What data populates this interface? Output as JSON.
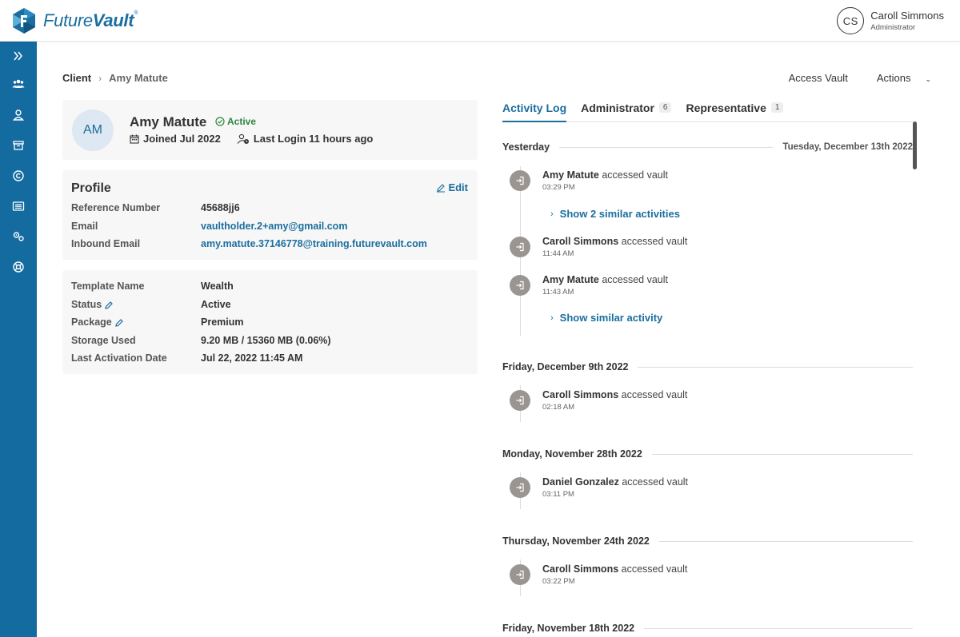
{
  "app": {
    "logo_text_a": "Future",
    "logo_text_b": "Vault",
    "logo_tm": "®"
  },
  "user": {
    "initials": "CS",
    "name": "Caroll Simmons",
    "role": "Administrator"
  },
  "sidebar": {
    "items": [
      {
        "icon": "expand-icon"
      },
      {
        "icon": "clients-icon"
      },
      {
        "icon": "user-icon"
      },
      {
        "icon": "archive-icon"
      },
      {
        "icon": "copyright-icon"
      },
      {
        "icon": "list-icon"
      },
      {
        "icon": "settings-icon"
      },
      {
        "icon": "support-icon"
      }
    ]
  },
  "breadcrumb": {
    "root": "Client",
    "separator": "›",
    "current": "Amy Matute"
  },
  "top_actions": {
    "access_vault": "Access Vault",
    "actions": "Actions",
    "actions_chevron": "⌄"
  },
  "client": {
    "initials": "AM",
    "name": "Amy Matute",
    "status": "Active",
    "joined": "Joined Jul 2022",
    "last_login": "Last Login 11 hours ago"
  },
  "profile": {
    "title": "Profile",
    "edit_label": "Edit",
    "fields": [
      {
        "label": "Reference Number",
        "value": "45688jj6"
      },
      {
        "label": "Email",
        "value": "vaultholder.2+amy@gmail.com"
      },
      {
        "label": "Inbound Email",
        "value": "amy.matute.37146778@training.futurevault.com"
      }
    ]
  },
  "details": {
    "fields": [
      {
        "label": "Template Name",
        "value": "Wealth"
      },
      {
        "label": "Status",
        "value": "Active"
      },
      {
        "label": "Package",
        "value": "Premium"
      },
      {
        "label": "Storage Used",
        "value": "9.20 MB / 15360 MB (0.06%)"
      },
      {
        "label": "Last Activation Date",
        "value": "Jul 22, 2022 11:45 AM"
      }
    ]
  },
  "tabs": [
    {
      "label": "Activity Log",
      "count": ""
    },
    {
      "label": "Administrator",
      "count": "6"
    },
    {
      "label": "Representative",
      "count": "1"
    }
  ],
  "activity": {
    "groups": [
      {
        "label": "Yesterday",
        "right_date": "Tuesday, December 13th 2022",
        "entries": [
          {
            "actor": "Amy Matute",
            "action": "accessed vault",
            "time": "03:29 PM"
          },
          {
            "similar": "Show 2 similar activities"
          },
          {
            "actor": "Caroll Simmons",
            "action": "accessed vault",
            "time": "11:44 AM"
          },
          {
            "actor": "Amy Matute",
            "action": "accessed vault",
            "time": "11:43 AM"
          },
          {
            "similar": "Show similar activity"
          }
        ]
      },
      {
        "label": "Friday, December 9th 2022",
        "entries": [
          {
            "actor": "Caroll Simmons",
            "action": "accessed vault",
            "time": "02:18 AM"
          }
        ]
      },
      {
        "label": "Monday, November 28th 2022",
        "entries": [
          {
            "actor": "Daniel Gonzalez",
            "action": "accessed vault",
            "time": "03:11 PM"
          }
        ]
      },
      {
        "label": "Thursday, November 24th 2022",
        "entries": [
          {
            "actor": "Caroll Simmons",
            "action": "accessed vault",
            "time": "03:22 PM"
          }
        ]
      },
      {
        "label": "Friday, November 18th 2022",
        "entries": []
      }
    ],
    "similar_chevron": "›"
  }
}
